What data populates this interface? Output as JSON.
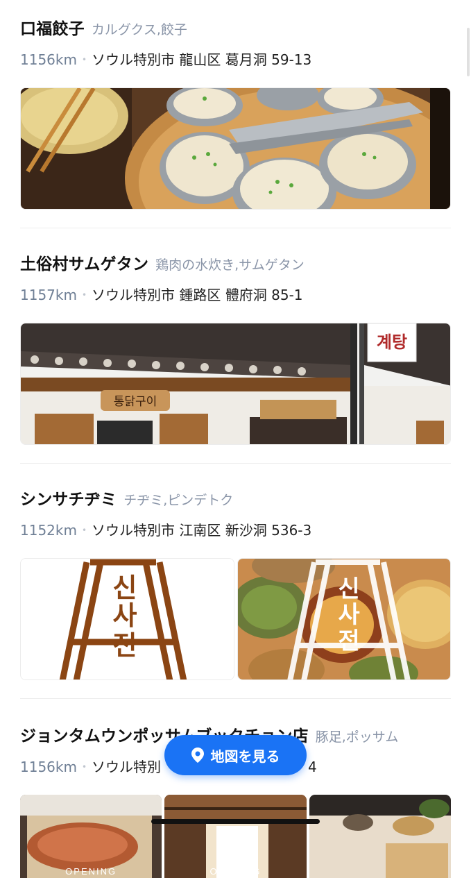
{
  "listings": [
    {
      "name": "口福餃子",
      "category": "カルグクス,餃子",
      "distance": "1156km",
      "address": "ソウル特別市 龍山区 葛月洞 59-13",
      "image": "dumplings-photo"
    },
    {
      "name": "土俗村サムゲタン",
      "category": "鶏肉の水炊き,サムゲタン",
      "distance": "1157km",
      "address": "ソウル特別市 鍾路区 體府洞 85-1",
      "image": "hanok-storefront-photo",
      "sign_text": "통닭구이",
      "banner_text": "계탕"
    },
    {
      "name": "シンサチヂミ",
      "category": "チヂミ,ピンデトク",
      "distance": "1152km",
      "address": "ソウル特別市 江南区 新沙洞 536-3",
      "image": "logo-and-jeon-photo",
      "logo_text": [
        "신",
        "사",
        "전"
      ]
    },
    {
      "name": "ジョンタムウンポッサムブックチョン店",
      "category": "豚足,ポッサム",
      "distance": "1156km",
      "address": "ソウル特別",
      "address_tail": "4",
      "image": "opening-photos",
      "badge_text": "OPENING"
    }
  ],
  "dot": "•",
  "map_button": {
    "label": "地図を見る",
    "icon": "map-pin-icon"
  },
  "colors": {
    "accent": "#1a73f5",
    "category": "#8a95a8",
    "distance": "#6f7f95"
  }
}
